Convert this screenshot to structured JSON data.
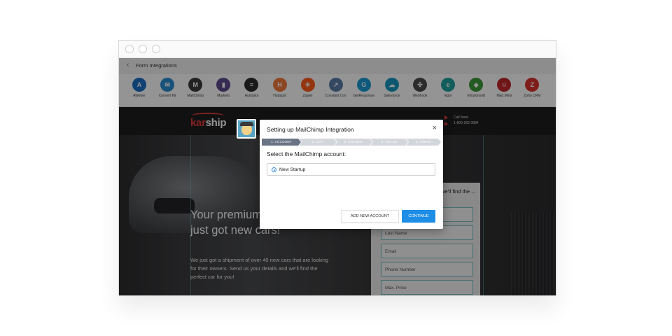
{
  "header": {
    "title": "Form Integrations",
    "back_icon": "chevron-left-icon"
  },
  "integrations": [
    {
      "label": "AWeber",
      "color": "#1a6ec4",
      "glyph": "A"
    },
    {
      "label": "Convert Kit",
      "color": "#2a8dd4",
      "glyph": "✉"
    },
    {
      "label": "MailChimp",
      "color": "#3b3b3b",
      "glyph": "M"
    },
    {
      "label": "Marketo",
      "color": "#5c4a8f",
      "glyph": "▮"
    },
    {
      "label": "Autopilot",
      "color": "#2b2b2b",
      "glyph": "≡"
    },
    {
      "label": "Hubspot",
      "color": "#f17a3b",
      "glyph": "H"
    },
    {
      "label": "Zapier",
      "color": "#ff5c1b",
      "glyph": "✳"
    },
    {
      "label": "Constant Con",
      "color": "#5a7fa8",
      "glyph": "↗"
    },
    {
      "label": "GetResponse",
      "color": "#1a9ad6",
      "glyph": "G"
    },
    {
      "label": "Salesforce",
      "color": "#1798c1",
      "glyph": "☁"
    },
    {
      "label": "Webhook",
      "color": "#4a4a4a",
      "glyph": "✣"
    },
    {
      "label": "Egoi",
      "color": "#1fa3a0",
      "glyph": "e"
    },
    {
      "label": "Infusionsoft",
      "color": "#3c9b3c",
      "glyph": "◆"
    },
    {
      "label": "Mad Mimi",
      "color": "#c3262a",
      "glyph": "☺"
    },
    {
      "label": "Zoho CRM",
      "color": "#d9332b",
      "glyph": "Z"
    }
  ],
  "landing": {
    "logo_prefix": "kar",
    "logo_suffix": "ship",
    "call_now": "Call Now!",
    "phone": "1-800-283-3884",
    "hero_title": "Your premium car dealership just got new cars!",
    "hero_text": "We just got a shipment of over 40 new cars that are looking for their owners. Send us your details and we'll find the perfect car for you!",
    "form_heading": "we'll find the ...",
    "fields": [
      "First Name",
      "Last Name",
      "Email",
      "Phone Number",
      "Max. Price"
    ]
  },
  "modal": {
    "title": "Setting up MailChimp Integration",
    "close_glyph": "×",
    "steps": [
      {
        "label": "1. ACCOUNT",
        "active": true
      },
      {
        "label": "2. LIST",
        "active": false
      },
      {
        "label": "3. GROUPS",
        "active": false
      },
      {
        "label": "4. FIELDS",
        "active": false
      },
      {
        "label": "5. FINISH",
        "active": false
      }
    ],
    "subtitle": "Select the MailChimp account:",
    "account": "New Startup",
    "add_button": "ADD NEW ACCOUNT",
    "continue_button": "CONTINUE"
  }
}
